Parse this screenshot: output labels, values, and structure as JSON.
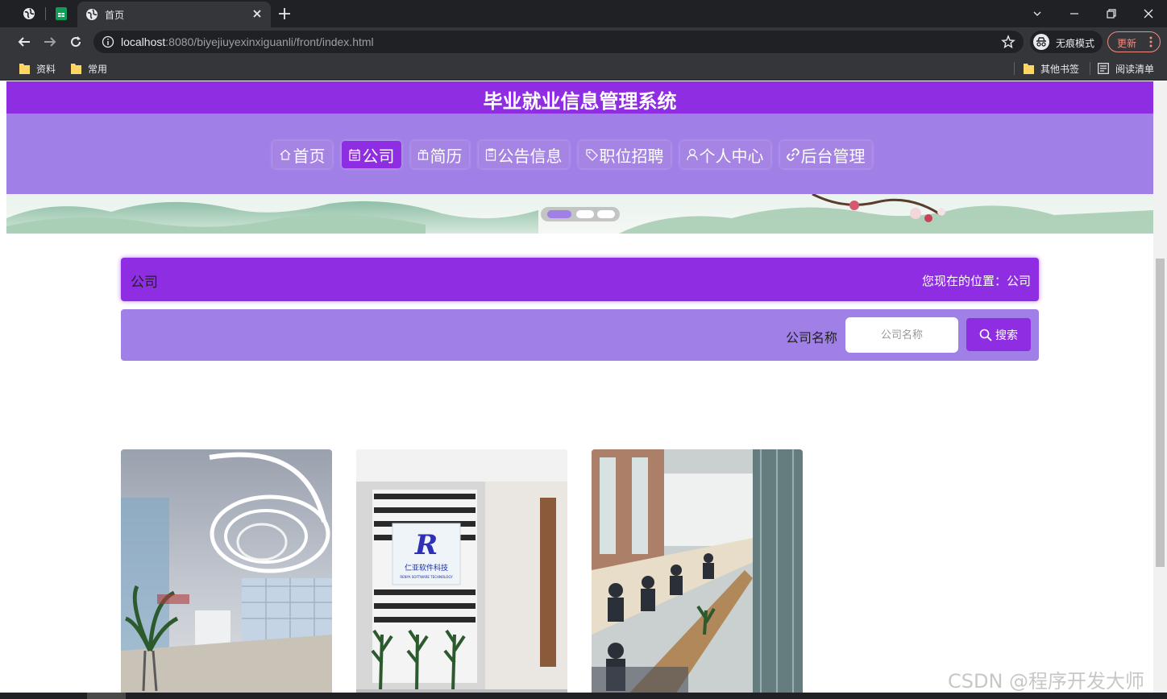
{
  "browser": {
    "tab_title": "首页",
    "url_host": "localhost",
    "url_rest": ":8080/biyejiuyexinxiguanli/front/index.html",
    "incognito_label": "无痕模式",
    "update_label": "更新",
    "bookmarks": [
      "资料",
      "常用"
    ],
    "bookmarks_right": [
      "其他书签",
      "阅读清单"
    ]
  },
  "site": {
    "title": "毕业就业信息管理系统",
    "nav": [
      {
        "label": "首页",
        "icon": "home-icon"
      },
      {
        "label": "公司",
        "icon": "company-icon",
        "active": true
      },
      {
        "label": "简历",
        "icon": "gift-icon"
      },
      {
        "label": "公告信息",
        "icon": "notice-icon"
      },
      {
        "label": "职位招聘",
        "icon": "tag-icon"
      },
      {
        "label": "个人中心",
        "icon": "user-icon"
      },
      {
        "label": "后台管理",
        "icon": "link-icon"
      }
    ]
  },
  "page": {
    "section_title": "公司",
    "location_label": "您现在的位置：公司"
  },
  "search": {
    "label": "公司名称",
    "placeholder": "公司名称",
    "button_label": "搜索"
  },
  "carousel": {
    "slides": 3,
    "active_index": 0
  },
  "company_cards": [
    {
      "image": "lobby-reception-photo"
    },
    {
      "image": "software-company-logo-wall-photo",
      "logo_text": "仁亚软件科技",
      "logo_sub": "RENYA SOFTWARE TECHNOLOGY"
    },
    {
      "image": "open-office-workspace-photo"
    }
  ],
  "watermark": "CSDN @程序开发大师",
  "colors": {
    "primary": "#8e2de2",
    "secondary": "#a07fe6",
    "chrome_dark": "#202124",
    "chrome_mid": "#35363a"
  }
}
